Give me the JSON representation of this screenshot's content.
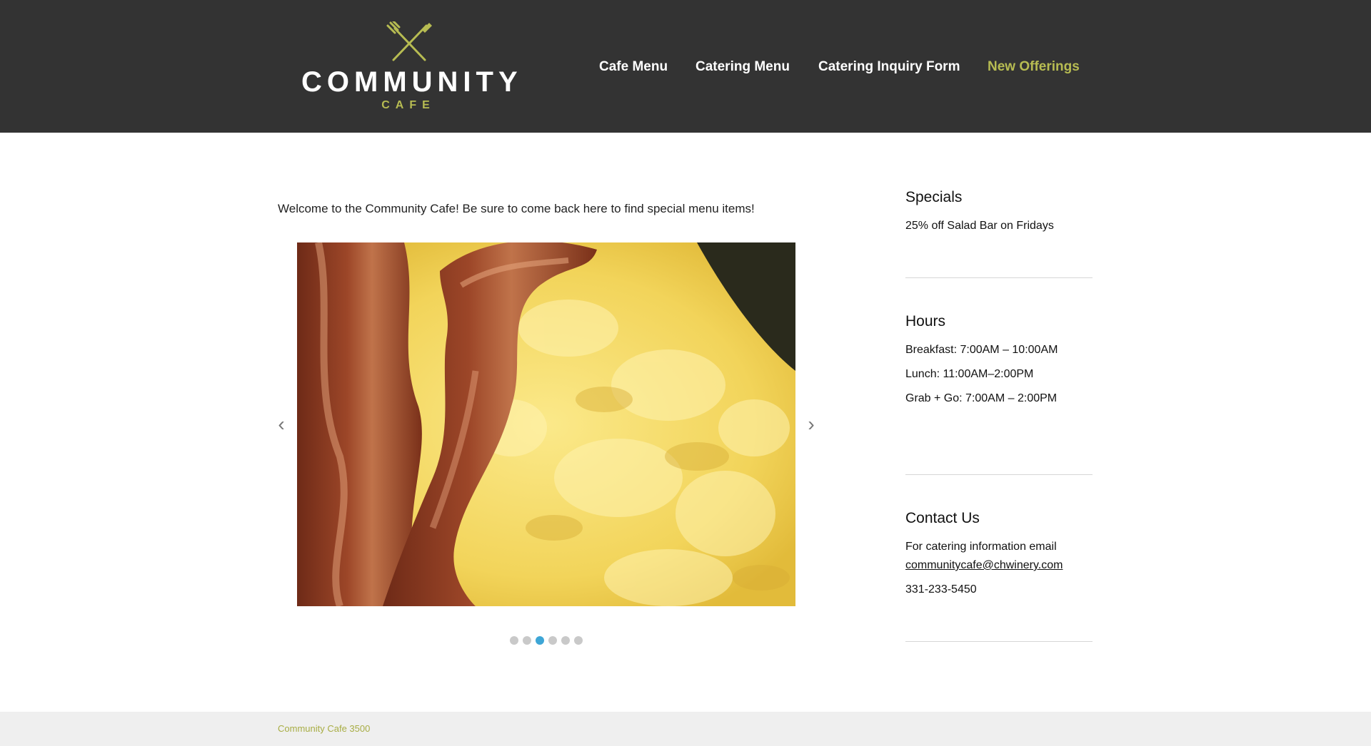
{
  "brand": {
    "name": "COMMUNITY",
    "sub": "CAFE",
    "logo_icon": "crossed-fork-knife-icon",
    "accent_color": "#b7bc52",
    "header_bg": "#333333"
  },
  "nav": {
    "items": [
      {
        "label": "Cafe Menu",
        "active": false
      },
      {
        "label": "Catering Menu",
        "active": false
      },
      {
        "label": "Catering Inquiry Form",
        "active": false
      },
      {
        "label": "New Offerings",
        "active": true
      }
    ]
  },
  "main": {
    "welcome": "Welcome to the Community Cafe! Be sure to come back here to find special menu items!",
    "slider": {
      "image": "bacon-and-scrambled-eggs-photo",
      "prev_icon": "chevron-left-icon",
      "next_icon": "chevron-right-icon",
      "dot_count": 6,
      "active_dot": 3,
      "active_dot_color": "#3ea6d6"
    }
  },
  "sidebar": {
    "specials": {
      "title": "Specials",
      "items": [
        "25% off Salad Bar on Fridays"
      ]
    },
    "hours": {
      "title": "Hours",
      "items": [
        "Breakfast: 7:00AM – 10:00AM",
        "Lunch: 11:00AM–2:00PM",
        "Grab + Go: 7:00AM – 2:00PM"
      ]
    },
    "contact": {
      "title": "Contact Us",
      "text": "For catering information email",
      "email": "communitycafe@chwinery.com",
      "phone": "331-233-5450"
    }
  },
  "footer": {
    "text": "Community Cafe 3500"
  }
}
